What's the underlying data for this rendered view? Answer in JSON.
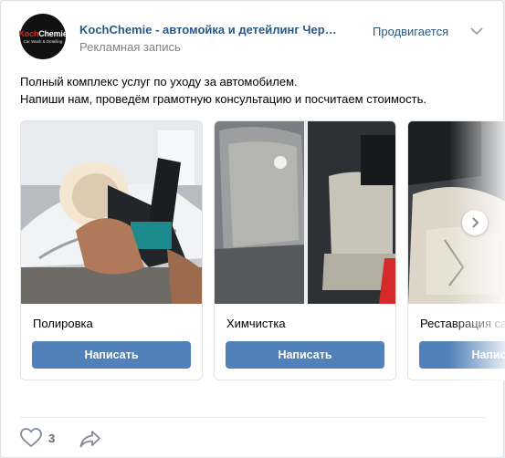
{
  "post": {
    "author": "KochChemie - автомойка и детейлинг Череповец",
    "subtitle": "Рекламная запись",
    "promoted": "Продвигается",
    "avatar": {
      "brand_part1": "Koch",
      "brand_part2": "Chemie",
      "tagline": "Car Wash & Detailing"
    },
    "text_line1": "Полный комплекс услуг по уходу за автомобилем.",
    "text_line2": "Напиши нам, проведём грамотную консультацию и посчитаем стоимость.",
    "likes": "3"
  },
  "carousel": {
    "cards": [
      {
        "title": "Полировка",
        "button": "Написать"
      },
      {
        "title": "Химчистка",
        "button": "Написать"
      },
      {
        "title": "Реставрация салона",
        "button": "Написать"
      }
    ]
  },
  "colors": {
    "link": "#2a5885",
    "button": "#5181b8",
    "muted": "#828282"
  }
}
